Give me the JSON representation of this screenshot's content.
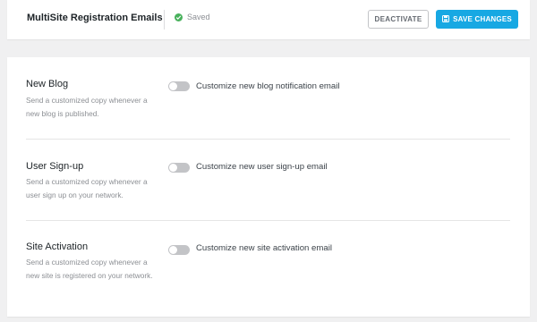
{
  "header": {
    "title": "MultiSite Registration Emails",
    "status": "Saved",
    "deactivate_label": "DEACTIVATE",
    "save_label": "SAVE CHANGES"
  },
  "sections": [
    {
      "title": "New Blog",
      "description": "Send a customized copy whenever a new blog is published.",
      "toggle_label": "Customize new blog notification email",
      "enabled": false
    },
    {
      "title": "User Sign-up",
      "description": "Send a customized copy whenever a user sign up on your network.",
      "toggle_label": "Customize new user sign-up email",
      "enabled": false
    },
    {
      "title": "Site Activation",
      "description": "Send a customized copy whenever a new site is registered on your network.",
      "toggle_label": "Customize new site activation email",
      "enabled": false
    }
  ],
  "colors": {
    "accent": "#17a8e3",
    "saved": "#48b15c",
    "toggle_off": "#c3c4c7"
  }
}
